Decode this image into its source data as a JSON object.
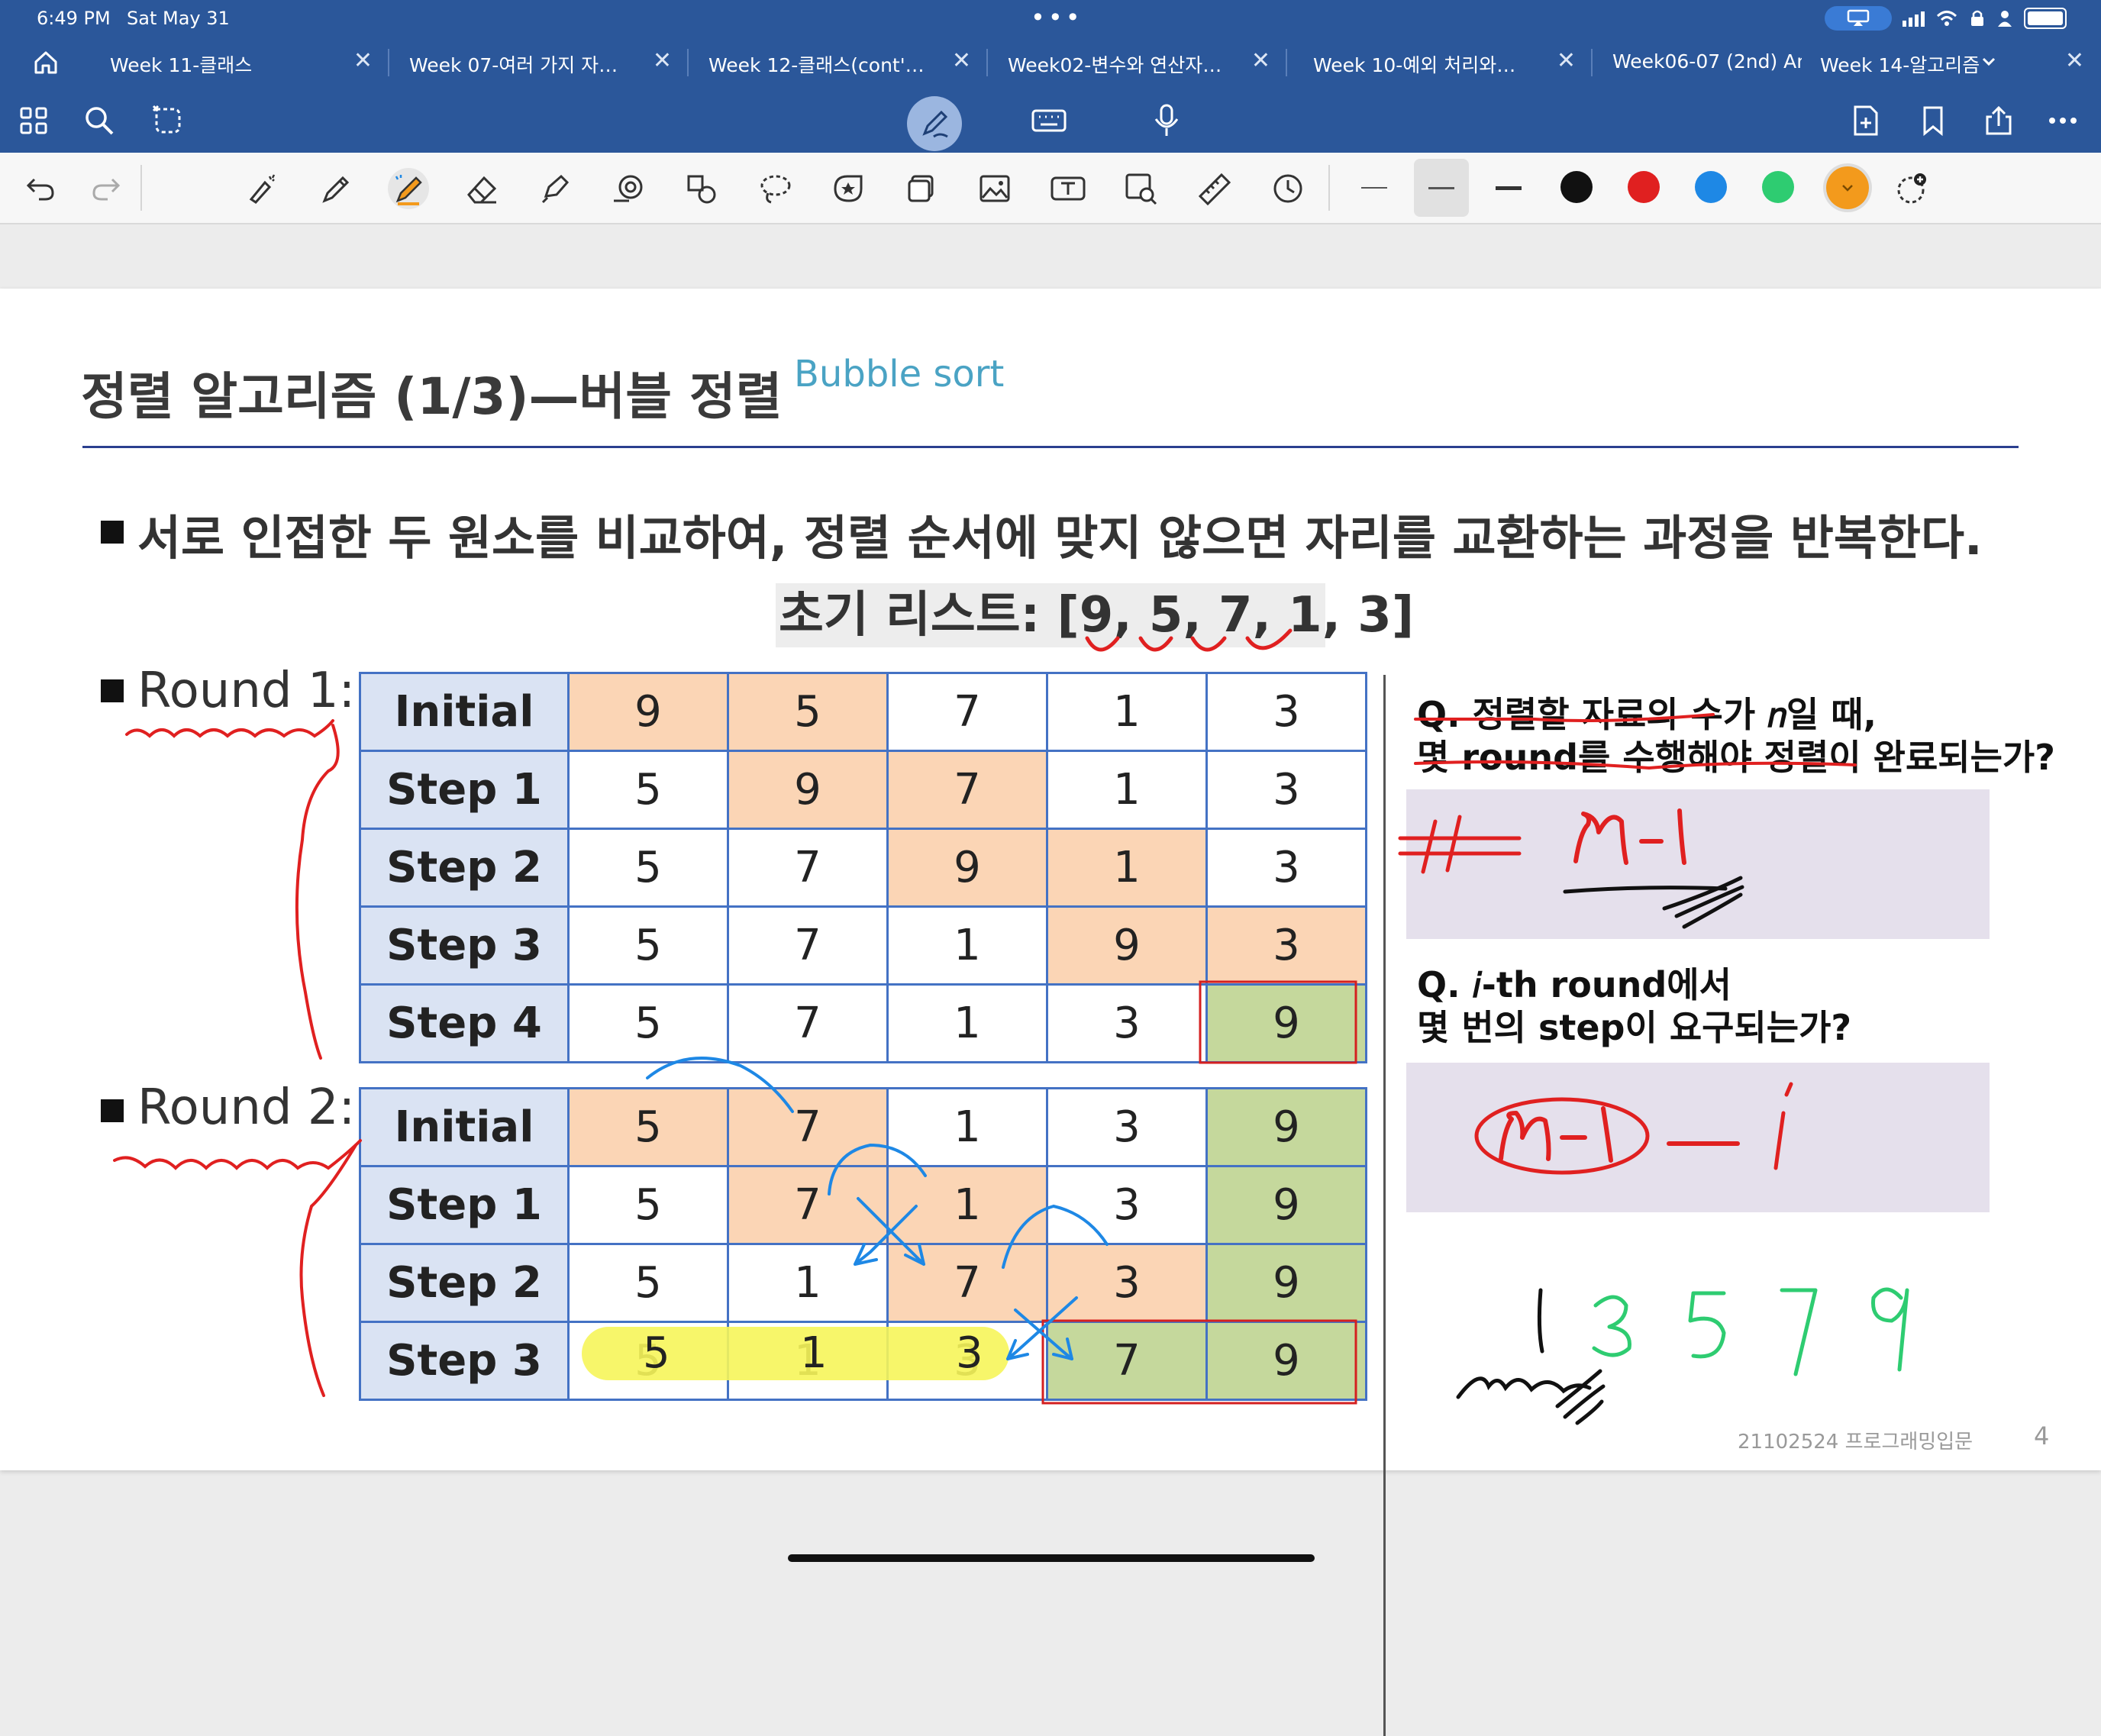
{
  "status": {
    "time": "6:49 PM",
    "date": "Sat May 31",
    "more": "•••"
  },
  "tabs": [
    {
      "label": "Week 11-클래스",
      "close": "✕"
    },
    {
      "label": "Week 07-여러 가지 자…",
      "close": "✕"
    },
    {
      "label": "Week 12-클래스(cont'…",
      "close": "✕"
    },
    {
      "label": "Week02-변수와 연산자…",
      "close": "✕"
    },
    {
      "label": "Week 10-예외 처리와…",
      "close": "✕"
    },
    {
      "label": "Week06-07 (2nd) An…",
      "close": ""
    },
    {
      "label": "Week 14-알고리즘",
      "close": "✕"
    }
  ],
  "toolbar_top_icons": [
    "grid-icon",
    "search-icon",
    "magic-shape-icon",
    "pen-mode-icon",
    "keyboard-icon",
    "microphone-icon",
    "new-page-icon",
    "bookmark-icon",
    "share-icon",
    "more-icon"
  ],
  "toolbar_tools": [
    "undo-icon",
    "redo-icon",
    "laser-pointer-icon",
    "pencil-icon",
    "fountain-pen-icon",
    "eraser-icon",
    "highlighter-icon",
    "shapes-icon",
    "elements-icon",
    "lasso-icon",
    "sticker-icon",
    "sticky-note-icon",
    "image-icon",
    "text-box-icon",
    "image-search-icon",
    "ruler-icon",
    "recent-icon"
  ],
  "colors": [
    "#111111",
    "#e02020",
    "#1e88e5",
    "#2ecc71",
    "#f39a1c"
  ],
  "slide": {
    "title": "정렬 알고리즘 (1/3)—버블 정렬",
    "subtitle": "Bubble sort",
    "bullet": "서로 인접한 두 원소를 비교하여, 정렬 순서에 맞지 않으면 자리를 교환하는 과정을 반복한다.",
    "initial_list": "초기 리스트: [9, 5, 7, 1, 3]",
    "round1_label": "Round 1:",
    "round2_label": "Round 2:",
    "round1": [
      {
        "label": "Initial",
        "values": [
          "9",
          "5",
          "7",
          "1",
          "3"
        ]
      },
      {
        "label": "Step 1",
        "values": [
          "5",
          "9",
          "7",
          "1",
          "3"
        ]
      },
      {
        "label": "Step 2",
        "values": [
          "5",
          "7",
          "9",
          "1",
          "3"
        ]
      },
      {
        "label": "Step 3",
        "values": [
          "5",
          "7",
          "1",
          "9",
          "3"
        ]
      },
      {
        "label": "Step 4",
        "values": [
          "5",
          "7",
          "1",
          "3",
          "9"
        ]
      }
    ],
    "round2": [
      {
        "label": "Initial",
        "values": [
          "5",
          "7",
          "1",
          "3",
          "9"
        ]
      },
      {
        "label": "Step 1",
        "values": [
          "5",
          "7",
          "1",
          "3",
          "9"
        ]
      },
      {
        "label": "Step 2",
        "values": [
          "5",
          "1",
          "7",
          "3",
          "9"
        ]
      },
      {
        "label": "Step 3",
        "values": [
          "5",
          "1",
          "3",
          "7",
          "9"
        ]
      }
    ],
    "q1_line1": "Q. 정렬할 자료의 수가 𝑛일 때,",
    "q1_line2": "몇 round를 수행해야 정렬이 완료되는가?",
    "q2_line1": "Q. 𝑖-th round에서",
    "q2_line2": "몇 번의 step이 요구되는가?",
    "footer": "21102524 프로그래밍입문",
    "page_number": "4"
  },
  "handwriting": {
    "answer1": "n-1",
    "answer2": "n-1 - i",
    "green_sequence": "3 5 7 9"
  }
}
